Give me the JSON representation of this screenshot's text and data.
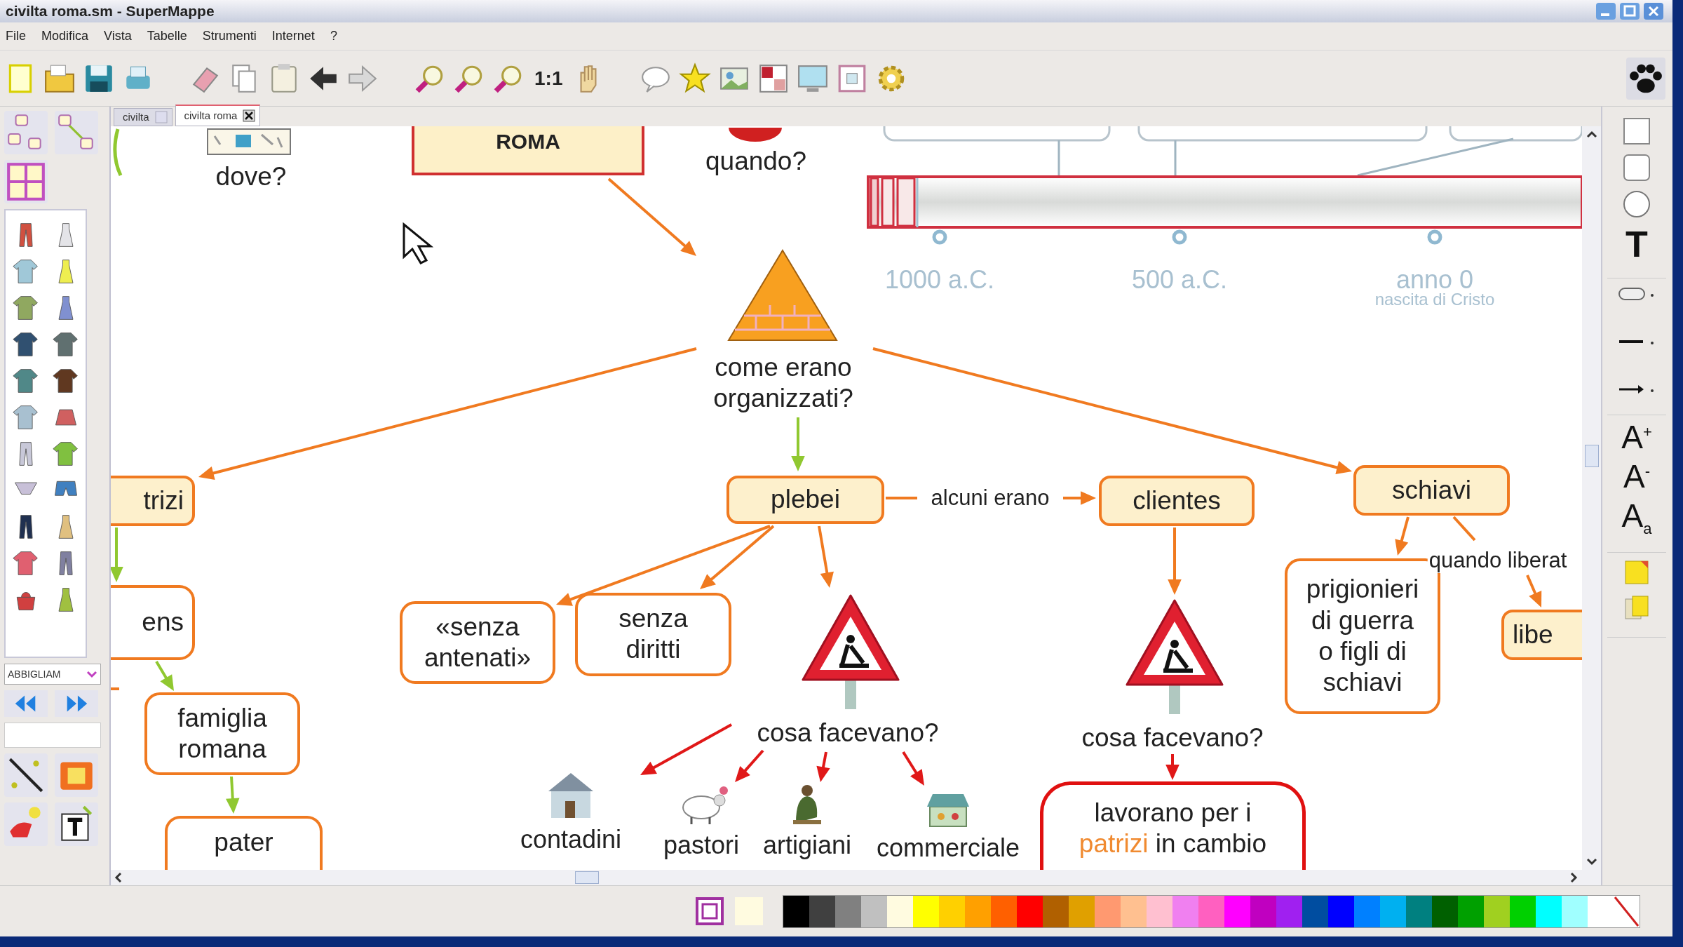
{
  "window": {
    "title": "civilta roma.sm - SuperMappe"
  },
  "menu": [
    "File",
    "Modifica",
    "Vista",
    "Tabelle",
    "Strumenti",
    "Internet",
    "?"
  ],
  "toolbar": {
    "zoom_reset": "1:1"
  },
  "tabs": [
    {
      "label": "civilta",
      "selected": false
    },
    {
      "label": "civilta roma",
      "selected": true
    }
  ],
  "left_panel": {
    "category": "ABBIGLIAM"
  },
  "right_panel": {
    "text_tool": "T",
    "font_tools": [
      {
        "kind": "grow",
        "letter": "A",
        "mark": "+"
      },
      {
        "kind": "shrink",
        "letter": "A",
        "mark": "-"
      },
      {
        "kind": "case",
        "letter": "A",
        "mark": "a"
      }
    ]
  },
  "map": {
    "boxes": [
      {
        "kind": "title",
        "text": "ROMA"
      },
      {
        "kind": "category",
        "text": "trizi"
      },
      {
        "kind": "category",
        "text": "plebei"
      },
      {
        "kind": "category",
        "text": "clientes"
      },
      {
        "kind": "category",
        "text": "schiavi"
      },
      {
        "kind": "detail",
        "text": "ens"
      },
      {
        "kind": "detail",
        "text": "«senza\nantenati»"
      },
      {
        "kind": "detail",
        "text": "senza\ndiritti"
      },
      {
        "kind": "detail",
        "text": "prigionieri\ndi guerra\no figli di\nschiavi"
      },
      {
        "kind": "category",
        "text": "libe"
      },
      {
        "kind": "detail",
        "text": "famiglia\nromana"
      },
      {
        "kind": "detail",
        "text": "pater"
      },
      {
        "kind": "note",
        "segments": [
          {
            "text": "lavorano per i\n",
            "highlight": false
          },
          {
            "text": "patrizi",
            "highlight": true
          },
          {
            "text": " in cambio",
            "highlight": false
          }
        ]
      }
    ],
    "labels": [
      "dove?",
      "quando?",
      "come erano\norganizzati?",
      "cosa facevano?",
      "cosa facevano?"
    ],
    "link_labels": [
      "alcuni erano",
      "quando liberat"
    ],
    "timeline": {
      "ticks": [
        {
          "label": "1000 a.C."
        },
        {
          "label": "500 a.C."
        },
        {
          "label": "anno 0",
          "note": "nascita di Cristo"
        }
      ]
    },
    "pictures": [
      {
        "caption": "contadini"
      },
      {
        "caption": "pastori"
      },
      {
        "caption": "artigiani"
      },
      {
        "caption": "commerciale"
      }
    ]
  },
  "palette": [
    {
      "kind": "color",
      "color": "#000000"
    },
    {
      "kind": "color",
      "color": "#404040"
    },
    {
      "kind": "color",
      "color": "#808080"
    },
    {
      "kind": "color",
      "color": "#c0c0c0"
    },
    {
      "kind": "color",
      "color": "#fffbe0"
    },
    {
      "kind": "color",
      "color": "#ffff00"
    },
    {
      "kind": "color",
      "color": "#ffd000"
    },
    {
      "kind": "color",
      "color": "#ffa000"
    },
    {
      "kind": "color",
      "color": "#ff6000"
    },
    {
      "kind": "color",
      "color": "#ff0000"
    },
    {
      "kind": "color",
      "color": "#b06000"
    },
    {
      "kind": "color",
      "color": "#e0a000"
    },
    {
      "kind": "color",
      "color": "#ff9970"
    },
    {
      "kind": "color",
      "color": "#ffc090"
    },
    {
      "kind": "color",
      "color": "#ffc0d0"
    },
    {
      "kind": "color",
      "color": "#f080f0"
    },
    {
      "kind": "color",
      "color": "#ff60c0"
    },
    {
      "kind": "color",
      "color": "#ff00ff"
    },
    {
      "kind": "color",
      "color": "#c000c0"
    },
    {
      "kind": "color",
      "color": "#a020f0"
    },
    {
      "kind": "color",
      "color": "#004da0"
    },
    {
      "kind": "color",
      "color": "#0000ff"
    },
    {
      "kind": "color",
      "color": "#0080ff"
    },
    {
      "kind": "color",
      "color": "#00b0f0"
    },
    {
      "kind": "color",
      "color": "#008080"
    },
    {
      "kind": "color",
      "color": "#006000"
    },
    {
      "kind": "color",
      "color": "#00a000"
    },
    {
      "kind": "color",
      "color": "#a0d020"
    },
    {
      "kind": "color",
      "color": "#00d000"
    },
    {
      "kind": "color",
      "color": "#00ffff"
    },
    {
      "kind": "color",
      "color": "#a0ffff"
    },
    {
      "kind": "color",
      "color": "#ffffff"
    },
    {
      "kind": "none"
    }
  ]
}
